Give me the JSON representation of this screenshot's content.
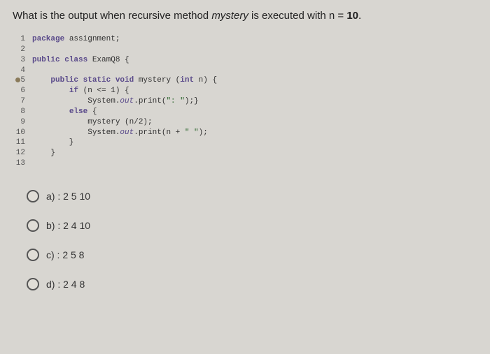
{
  "question": {
    "prefix": "What is the output when recursive method ",
    "method_name": "mystery",
    "middle": " is executed with n = ",
    "n_value": "10",
    "suffix": "."
  },
  "code": {
    "lines": [
      {
        "num": "1",
        "bp": false,
        "text": "package assignment;",
        "tokens": [
          {
            "t": "package",
            "c": "kw"
          },
          {
            "t": " assignment;",
            "c": ""
          }
        ]
      },
      {
        "num": "2",
        "bp": false,
        "text": "",
        "tokens": []
      },
      {
        "num": "3",
        "bp": false,
        "text": "public class ExamQ8 {",
        "tokens": [
          {
            "t": "public class",
            "c": "kw"
          },
          {
            "t": " ExamQ8 {",
            "c": ""
          }
        ]
      },
      {
        "num": "4",
        "bp": false,
        "text": "",
        "tokens": []
      },
      {
        "num": "5",
        "bp": true,
        "text": "    public static void mystery (int n) {",
        "tokens": [
          {
            "t": "    ",
            "c": ""
          },
          {
            "t": "public static void",
            "c": "kw"
          },
          {
            "t": " mystery (",
            "c": ""
          },
          {
            "t": "int",
            "c": "kw"
          },
          {
            "t": " n) {",
            "c": ""
          }
        ]
      },
      {
        "num": "6",
        "bp": false,
        "text": "        if (n <= 1) {",
        "tokens": [
          {
            "t": "        ",
            "c": ""
          },
          {
            "t": "if",
            "c": "kw"
          },
          {
            "t": " (n <= 1) {",
            "c": ""
          }
        ]
      },
      {
        "num": "7",
        "bp": false,
        "text": "            System.out.print(\": \");}",
        "tokens": [
          {
            "t": "            System.",
            "c": ""
          },
          {
            "t": "out",
            "c": "ref"
          },
          {
            "t": ".print(",
            "c": ""
          },
          {
            "t": "\": \"",
            "c": "str"
          },
          {
            "t": ");}",
            "c": ""
          }
        ]
      },
      {
        "num": "8",
        "bp": false,
        "text": "        else {",
        "tokens": [
          {
            "t": "        ",
            "c": ""
          },
          {
            "t": "else",
            "c": "kw"
          },
          {
            "t": " {",
            "c": ""
          }
        ]
      },
      {
        "num": "9",
        "bp": false,
        "text": "            mystery (n/2);",
        "tokens": [
          {
            "t": "            mystery (n/2);",
            "c": ""
          }
        ]
      },
      {
        "num": "10",
        "bp": false,
        "text": "            System.out.print(n + \" \");",
        "tokens": [
          {
            "t": "            System.",
            "c": ""
          },
          {
            "t": "out",
            "c": "ref"
          },
          {
            "t": ".print(n + ",
            "c": ""
          },
          {
            "t": "\" \"",
            "c": "str"
          },
          {
            "t": ");",
            "c": ""
          }
        ]
      },
      {
        "num": "11",
        "bp": false,
        "text": "        }",
        "tokens": [
          {
            "t": "        }",
            "c": ""
          }
        ]
      },
      {
        "num": "12",
        "bp": false,
        "text": "    }",
        "tokens": [
          {
            "t": "    }",
            "c": ""
          }
        ]
      },
      {
        "num": "13",
        "bp": false,
        "text": "",
        "tokens": []
      }
    ]
  },
  "options": [
    {
      "key": "a",
      "label": "a) : 2 5 10"
    },
    {
      "key": "b",
      "label": "b) : 2 4 10"
    },
    {
      "key": "c",
      "label": "c) : 2 5 8"
    },
    {
      "key": "d",
      "label": "d) : 2 4 8"
    }
  ]
}
